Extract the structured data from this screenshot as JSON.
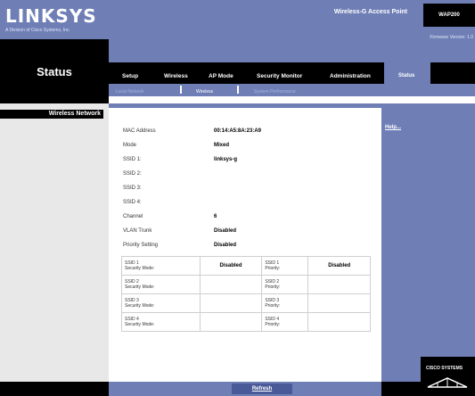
{
  "brand": {
    "logo": "LINKSYS",
    "subtitle": "A Division of Cisco Systems, Inc.",
    "firmware": "Firmware Version: 1.0"
  },
  "page": {
    "title": "Status",
    "product_name": "Wireless-G Access Point",
    "model": "WAP200"
  },
  "nav": {
    "items": [
      {
        "label": "Setup"
      },
      {
        "label": "Wireless"
      },
      {
        "label": "AP Mode"
      },
      {
        "label": "Security Monitor"
      },
      {
        "label": "Administration"
      },
      {
        "label": "Status"
      }
    ],
    "active": "Status"
  },
  "subnav": {
    "items": [
      {
        "label": "Local Network"
      },
      {
        "label": "Wireless"
      },
      {
        "label": "System Performance"
      }
    ],
    "active": "Wireless"
  },
  "section": {
    "title": "Wireless Network"
  },
  "help": {
    "label": "Help..."
  },
  "fields": [
    {
      "label": "MAC Address",
      "value": "00:14:A5:8A:23:A9"
    },
    {
      "label": "Mode",
      "value": "Mixed"
    },
    {
      "label": "SSID 1:",
      "value": "linksys-g"
    },
    {
      "label": "SSID 2:",
      "value": ""
    },
    {
      "label": "SSID 3:",
      "value": ""
    },
    {
      "label": "SSID 4:",
      "value": ""
    },
    {
      "label": "Channel",
      "value": "6"
    },
    {
      "label": "VLAN Trunk",
      "value": "Disabled"
    },
    {
      "label": "Priority Setting",
      "value": "Disabled"
    }
  ],
  "security_table": [
    {
      "ssid": "SSID 1",
      "mode_label": "Security Mode:",
      "mode_value": "Disabled",
      "prio_ssid": "SSID 1",
      "prio_label": "Priority:",
      "prio_value": "Disabled"
    },
    {
      "ssid": "SSID 2",
      "mode_label": "Security Mode:",
      "mode_value": "",
      "prio_ssid": "SSID 2",
      "prio_label": "Priority:",
      "prio_value": ""
    },
    {
      "ssid": "SSID 3",
      "mode_label": "Security Mode:",
      "mode_value": "",
      "prio_ssid": "SSID 3",
      "prio_label": "Priority:",
      "prio_value": ""
    },
    {
      "ssid": "SSID 4",
      "mode_label": "Security Mode:",
      "mode_value": "",
      "prio_ssid": "SSID 4",
      "prio_label": "Priority:",
      "prio_value": ""
    }
  ],
  "buttons": {
    "refresh": "Refresh"
  },
  "footer": {
    "cisco": "CISCO SYSTEMS"
  },
  "colors": {
    "accent": "#6f7fb6",
    "dark": "#000000"
  }
}
